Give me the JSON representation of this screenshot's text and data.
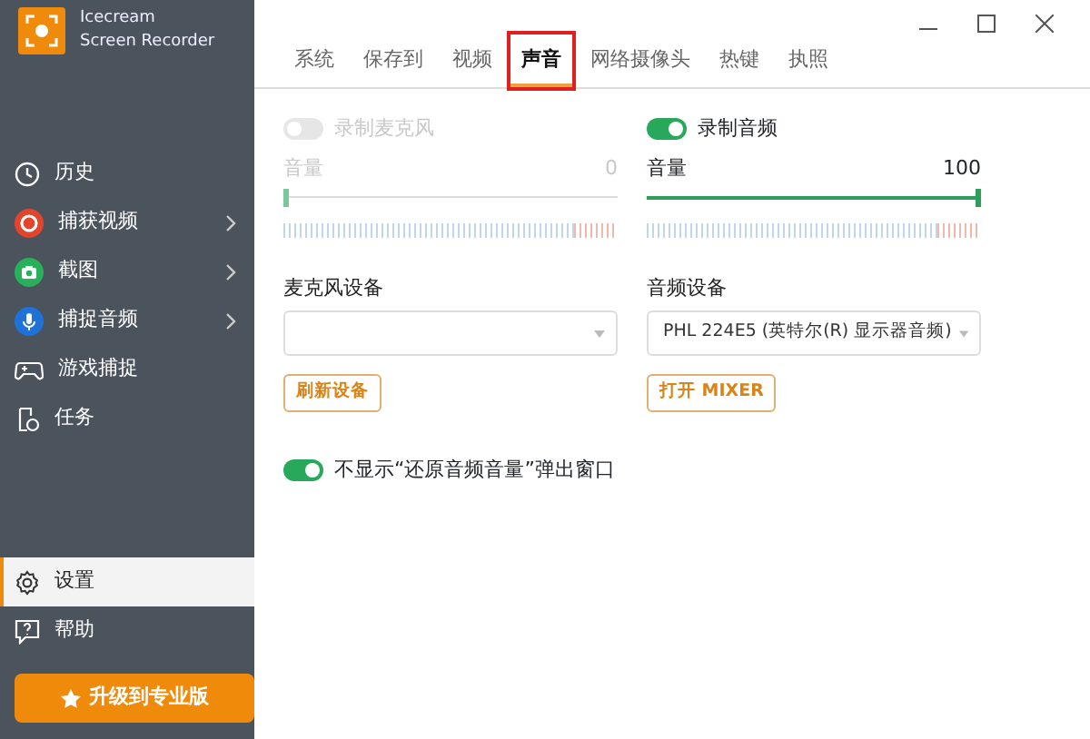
{
  "window": {
    "app_name": "Icecream",
    "app_subtitle": "Screen Recorder"
  },
  "sidebar": {
    "items": [
      {
        "label": "历史",
        "has_submenu": false,
        "selected": false
      },
      {
        "label": "捕获视频",
        "has_submenu": true,
        "selected": false
      },
      {
        "label": "截图",
        "has_submenu": true,
        "selected": false
      },
      {
        "label": "捕捉音频",
        "has_submenu": true,
        "selected": false
      },
      {
        "label": "游戏捕捉",
        "has_submenu": false,
        "selected": false
      },
      {
        "label": "任务",
        "has_submenu": false,
        "selected": false
      }
    ],
    "bottom_items": [
      {
        "label": "设置",
        "selected": true
      },
      {
        "label": "帮助",
        "selected": false
      }
    ],
    "upgrade_button": "升级到专业版"
  },
  "tabs": [
    {
      "label": "系统",
      "selected": false,
      "highlighted": false
    },
    {
      "label": "保存到",
      "selected": false,
      "highlighted": false
    },
    {
      "label": "视频",
      "selected": false,
      "highlighted": false
    },
    {
      "label": "声音",
      "selected": true,
      "highlighted": true
    },
    {
      "label": "网络摄像头",
      "selected": false,
      "highlighted": false
    },
    {
      "label": "热键",
      "selected": false,
      "highlighted": false
    },
    {
      "label": "执照",
      "selected": false,
      "highlighted": false
    }
  ],
  "columns": [
    {
      "toggle_label": "录制麦克风",
      "on": false,
      "disabled": true,
      "volume_label": "音量",
      "volume_value": "0",
      "level": 0,
      "device_label": "麦克风设备",
      "button": "刷新设备"
    },
    {
      "toggle_label": "录制音频",
      "on": true,
      "disabled": false,
      "volume_label": "音量",
      "volume_value": "100",
      "level": 1,
      "device_label": "音频设备",
      "device_value": "PHL 224E5 (英特尔(R) 显示器音频)",
      "button": "打开 MIXER"
    }
  ],
  "popup_toggle": {
    "label": "不显示“还原音频音量”弹出窗口",
    "on": true
  }
}
